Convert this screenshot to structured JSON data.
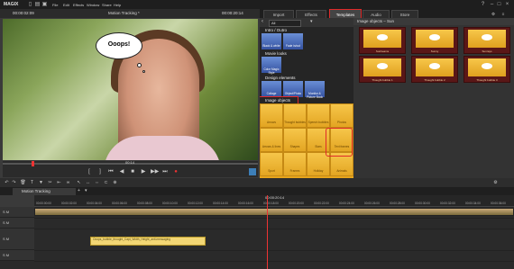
{
  "app": {
    "brand": "MAGIX",
    "menu": [
      "File",
      "Edit",
      "Effects",
      "Window",
      "Share",
      "Help"
    ]
  },
  "preview": {
    "timecode_left": "00:00:02:09",
    "title": "Motion Tracking *",
    "timecode_right": "00:00:20:14",
    "bubble_text": "Ooops!",
    "scrub_label": "00:14"
  },
  "media_pool": {
    "tabs": [
      "Import",
      "Effects",
      "Templates",
      "Audio",
      "Store"
    ],
    "active_tab": "Templates",
    "filter_value": "All",
    "sections": [
      {
        "label": "Intro / Outro",
        "tiles": [
          "Black & white",
          "Fade in/out"
        ]
      },
      {
        "label": "Movie looks",
        "tiles": [
          "Color Magic Style"
        ]
      },
      {
        "label": "Design elements",
        "tiles": [
          "Collage",
          "Object/Photo",
          "Monitor & Picture Book"
        ]
      },
      {
        "label": "Image objects",
        "tiles": [
          "Arrows",
          "Thought bubbles",
          "Speech bubbles",
          "Photos",
          "Arrows & lines",
          "Shapes",
          "Stars",
          "Text frames",
          "Sport",
          "Frames",
          "Holiday",
          "Animals",
          "Tools",
          "Birthday",
          "Travel",
          "Objects"
        ]
      }
    ],
    "highlighted_tile": "Speech bubbles",
    "preview_header": "Image objects – Sun",
    "preview_items": [
      "Sunbeams",
      "Sunny",
      "Sunrays",
      "Thought bubble 1",
      "Thought bubble 2",
      "Thought bubble 3"
    ]
  },
  "timeline": {
    "tab_label": "Motion Tracking",
    "ruler_center": "00:00:20:14",
    "ruler_labels": [
      "00:00:00:00",
      "00:00:02:00",
      "00:00:04:00",
      "00:00:06:00",
      "00:00:08:00",
      "00:00:10:00",
      "00:00:12:00",
      "00:00:14:00",
      "00:00:16:00",
      "00:00:18:00",
      "00:00:20:00",
      "00:00:22:00",
      "00:00:24:00",
      "00:00:26:00",
      "00:00:28:00",
      "00:00:30:00",
      "00:00:32:00",
      "00:00:34:00",
      "00:00:36:00"
    ],
    "track_labels": [
      "S M",
      "S M",
      "S M",
      "S M"
    ],
    "object_clip_label": "Ooops_bubble_thought_Capt_Width_Height_anti-messaging"
  }
}
